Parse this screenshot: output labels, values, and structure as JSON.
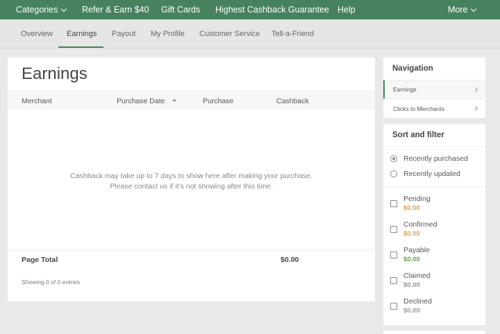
{
  "topnav": {
    "categories": "Categories",
    "refer": "Refer & Earn $40",
    "gift_cards": "Gift Cards",
    "guarantee": "Highest Cashback Guarantee",
    "help": "Help",
    "more": "More"
  },
  "subnav": {
    "overview": "Overview",
    "earnings": "Earnings",
    "payout": "Payout",
    "profile": "My Profile",
    "customer_service": "Customer Service",
    "tell_friend": "Tell-a-Friend"
  },
  "main": {
    "title": "Earnings",
    "columns": {
      "merchant": "Merchant",
      "purchase_date": "Purchase Date",
      "purchase": "Purchase",
      "cashback": "Cashback"
    },
    "empty_line1": "Cashback may take up to 7 days to show here after making your purchase.",
    "empty_line2": "Please contact us if it's not showing after this time.",
    "page_total_label": "Page Total",
    "page_total_value": "$0.00",
    "entries": "Showing 0 of 0 entries"
  },
  "sidebar": {
    "navigation": {
      "title": "Navigation",
      "items": [
        {
          "label": "Earnings"
        },
        {
          "label": "Clicks to Merchants"
        }
      ]
    },
    "filter": {
      "title": "Sort and filter",
      "sort_options": [
        {
          "label": "Recently purchased",
          "selected": true
        },
        {
          "label": "Recently updated",
          "selected": false
        }
      ],
      "statuses": [
        {
          "label": "Pending",
          "amount": "$0.00",
          "color": "#e0a050"
        },
        {
          "label": "Confirmed",
          "amount": "$0.00",
          "color": "#e0a050"
        },
        {
          "label": "Payable",
          "amount": "$0.00",
          "color": "#6da042"
        },
        {
          "label": "Claimed",
          "amount": "$0.00",
          "color": "#999999"
        },
        {
          "label": "Declined",
          "amount": "$0.00",
          "color": "#999999"
        }
      ]
    }
  }
}
